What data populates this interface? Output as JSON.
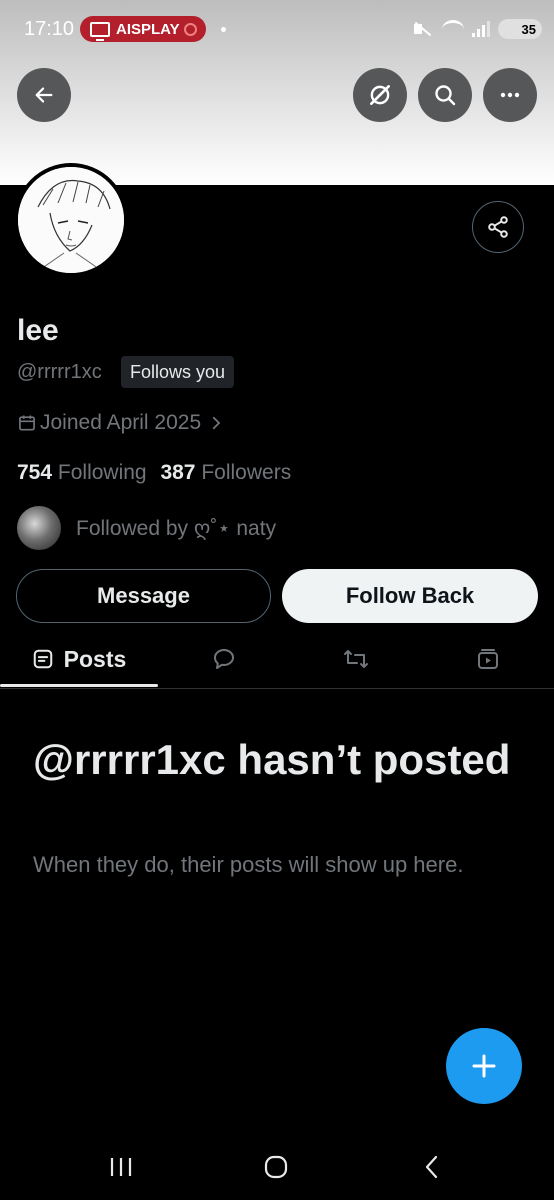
{
  "status_bar": {
    "time": "17:10",
    "cast_label": "AISPLAY",
    "battery": "35"
  },
  "header": {
    "back_icon": "arrow-left-icon",
    "grok_icon": "grok-icon",
    "search_icon": "search-icon",
    "more_icon": "more-icon"
  },
  "profile": {
    "name": "lee",
    "handle": "@rrrrr1xc",
    "follows_you": "Follows you",
    "joined": "Joined April 2025",
    "following_count": "754",
    "following_label": "Following",
    "followers_count": "387",
    "followers_label": "Followers",
    "followed_by": "Followed by ღ˚⋆ naty"
  },
  "actions": {
    "message": "Message",
    "follow_back": "Follow Back"
  },
  "tabs": {
    "posts": "Posts"
  },
  "empty_state": {
    "title": "@rrrrr1xc hasn’t posted",
    "subtitle": "When they do, their posts will show up here."
  },
  "colors": {
    "background": "#000000",
    "accent": "#1d9bf0",
    "muted_text": "#71767b",
    "cast_pill": "#b3202b"
  }
}
